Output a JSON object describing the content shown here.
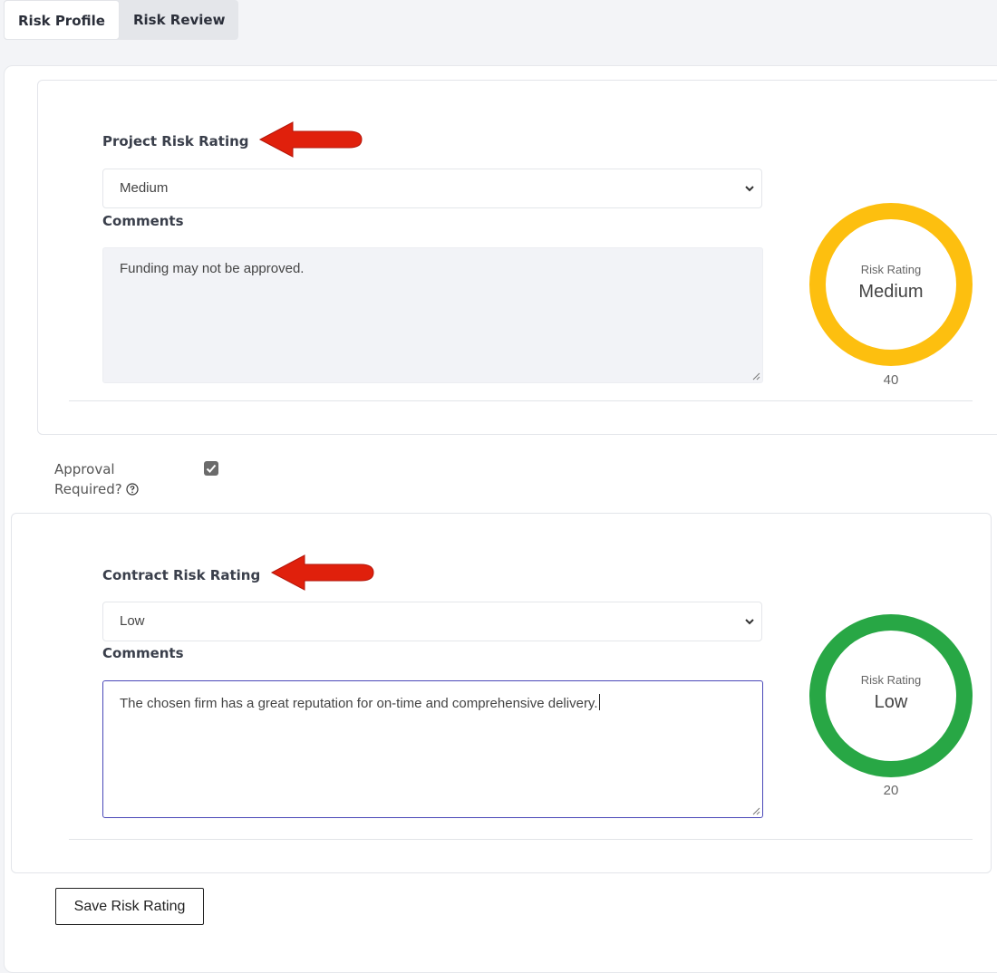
{
  "tabs": [
    {
      "label": "Risk Profile",
      "active": true
    },
    {
      "label": "Risk Review",
      "active": false
    }
  ],
  "project": {
    "label": "Project Risk Rating",
    "selected": "Medium",
    "comments_label": "Comments",
    "comments": "Funding may not be approved.",
    "gauge": {
      "caption": "Risk Rating",
      "rating": "Medium",
      "score": "40",
      "color": "#fdbf0f"
    }
  },
  "approval": {
    "label_line1": "Approval",
    "label_line2": "Required?",
    "checked": true,
    "help_icon": "question-circle-icon"
  },
  "contract": {
    "label": "Contract Risk Rating",
    "selected": "Low",
    "comments_label": "Comments",
    "comments": "The chosen firm has a great reputation for on-time and comprehensive delivery.",
    "gauge": {
      "caption": "Risk Rating",
      "rating": "Low",
      "score": "20",
      "color": "#28a745"
    }
  },
  "annotations": {
    "arrow_color": "#e0200c"
  },
  "actions": {
    "save_label": "Save Risk Rating"
  }
}
